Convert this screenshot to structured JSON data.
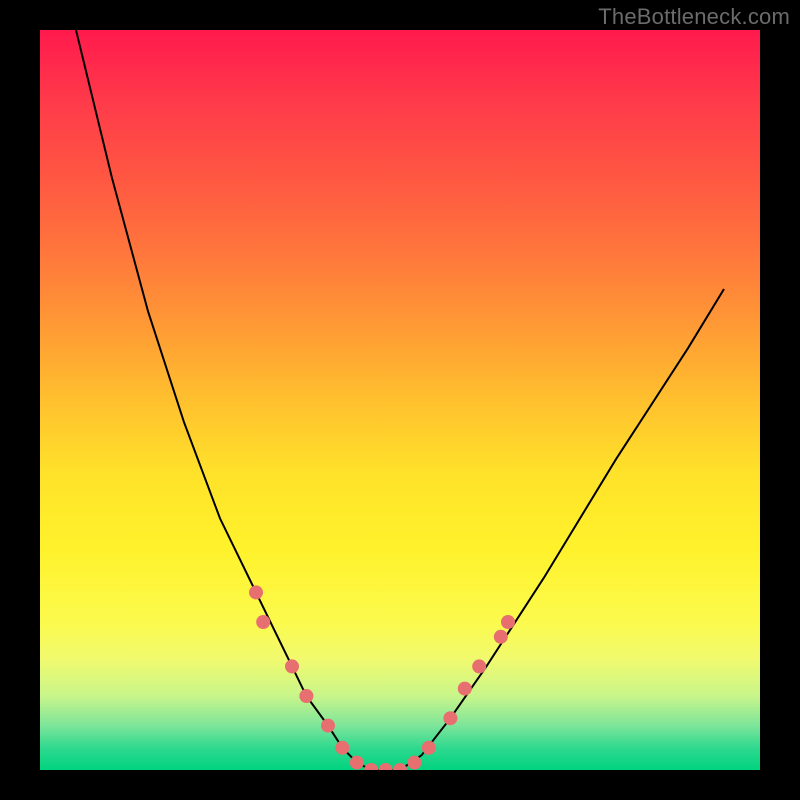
{
  "watermark": "TheBottleneck.com",
  "chart_data": {
    "type": "line",
    "title": "",
    "xlabel": "",
    "ylabel": "",
    "xlim": [
      0,
      100
    ],
    "ylim": [
      0,
      100
    ],
    "grid": false,
    "legend": false,
    "series": [
      {
        "name": "curve",
        "x": [
          5,
          10,
          15,
          20,
          25,
          30,
          34,
          37,
          40,
          42,
          44,
          46,
          50,
          53,
          57,
          62,
          70,
          80,
          90,
          95
        ],
        "y": [
          100,
          80,
          62,
          47,
          34,
          24,
          16,
          10,
          6,
          3,
          1,
          0,
          0,
          2,
          7,
          14,
          26,
          42,
          57,
          65
        ]
      }
    ],
    "markers": [
      {
        "x": 30,
        "y": 24
      },
      {
        "x": 31,
        "y": 20
      },
      {
        "x": 35,
        "y": 14
      },
      {
        "x": 37,
        "y": 10
      },
      {
        "x": 40,
        "y": 6
      },
      {
        "x": 42,
        "y": 3
      },
      {
        "x": 44,
        "y": 1
      },
      {
        "x": 46,
        "y": 0
      },
      {
        "x": 48,
        "y": 0
      },
      {
        "x": 50,
        "y": 0
      },
      {
        "x": 52,
        "y": 1
      },
      {
        "x": 54,
        "y": 3
      },
      {
        "x": 57,
        "y": 7
      },
      {
        "x": 59,
        "y": 11
      },
      {
        "x": 61,
        "y": 14
      },
      {
        "x": 64,
        "y": 18
      },
      {
        "x": 65,
        "y": 20
      }
    ],
    "marker_color": "#e76f6f",
    "line_color": "#000000",
    "line_width": 2,
    "marker_radius": 7
  }
}
